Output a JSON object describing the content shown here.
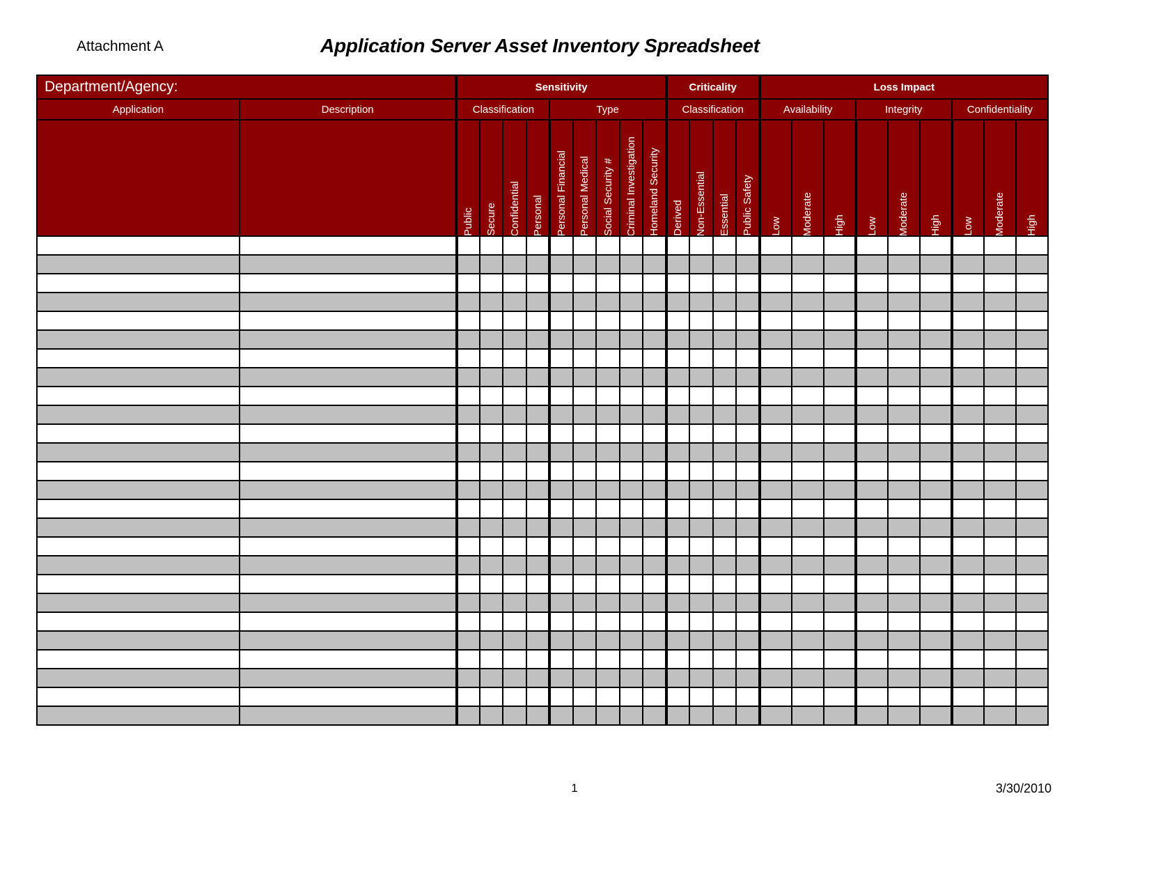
{
  "header": {
    "attachment": "Attachment A",
    "title": "Application Server Asset Inventory Spreadsheet"
  },
  "table": {
    "department_label": "Department/Agency:",
    "groups": {
      "sensitivity": "Sensitivity",
      "criticality": "Criticality",
      "loss_impact": "Loss Impact"
    },
    "subgroups": {
      "application": "Application",
      "description": "Description",
      "sensitivity_classification": "Classification",
      "sensitivity_type": "Type",
      "criticality_classification": "Classification",
      "availability": "Availability",
      "integrity": "Integrity",
      "confidentiality": "Confidentiality"
    },
    "columns": {
      "sensitivity_classification": [
        "Public",
        "Secure",
        "Confidential",
        "Personal"
      ],
      "sensitivity_type": [
        "Personal Financial",
        "Personal Medical",
        "Social Security #",
        "Criminal Investigation",
        "Homeland Security"
      ],
      "criticality_classification": [
        "Derived",
        "Non-Essential",
        "Essential",
        "Public Safety"
      ],
      "availability": [
        "Low",
        "Moderate",
        "High"
      ],
      "integrity": [
        "Low",
        "Moderate",
        "High"
      ],
      "confidentiality": [
        "Low",
        "Moderate",
        "High"
      ]
    },
    "row_count": 26,
    "colors": {
      "header_background": "#8B0000",
      "header_text": "#FFFFFF",
      "row_odd": "#FFFFFF",
      "row_even": "#C0C0C0",
      "border": "#000000"
    }
  },
  "footer": {
    "page_number": "1",
    "date": "3/30/2010"
  }
}
